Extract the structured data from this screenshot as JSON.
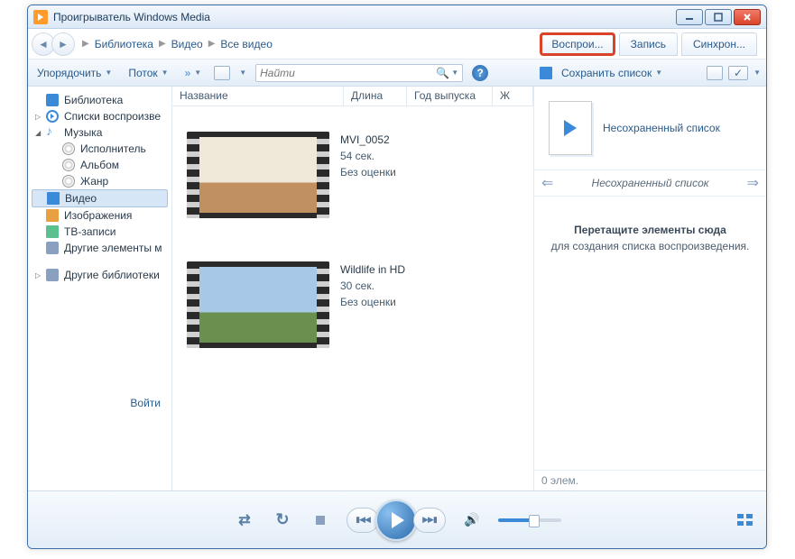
{
  "window": {
    "title": "Проигрыватель Windows Media"
  },
  "breadcrumb": {
    "a": "Библиотека",
    "b": "Видео",
    "c": "Все видео"
  },
  "tabs": {
    "play": "Воспрои...",
    "burn": "Запись",
    "sync": "Синхрон..."
  },
  "toolbar": {
    "organize": "Упорядочить",
    "stream": "Поток",
    "search_placeholder": "Найти"
  },
  "sidebar": {
    "library": "Библиотека",
    "playlists": "Списки воспроизве",
    "music": "Музыка",
    "artist": "Исполнитель",
    "album": "Альбом",
    "genre": "Жанр",
    "video": "Видео",
    "images": "Изображения",
    "tv": "ТВ-записи",
    "other": "Другие элементы м",
    "otherlibs": "Другие библиотеки",
    "login": "Войти"
  },
  "columns": {
    "name": "Название",
    "length": "Длина",
    "year": "Год выпуска",
    "g": "Ж"
  },
  "videos": [
    {
      "title": "MVI_0052",
      "dur": "54 сек.",
      "rating": "Без оценки"
    },
    {
      "title": "Wildlife in HD",
      "dur": "30 сек.",
      "rating": "Без оценки"
    }
  ],
  "playlist": {
    "save": "Сохранить список",
    "unsaved": "Несохраненный список",
    "nav_title": "Несохраненный список",
    "drop_h": "Перетащите элементы сюда",
    "drop_s": "для создания списка воспроизведения.",
    "count": "0 элем."
  }
}
